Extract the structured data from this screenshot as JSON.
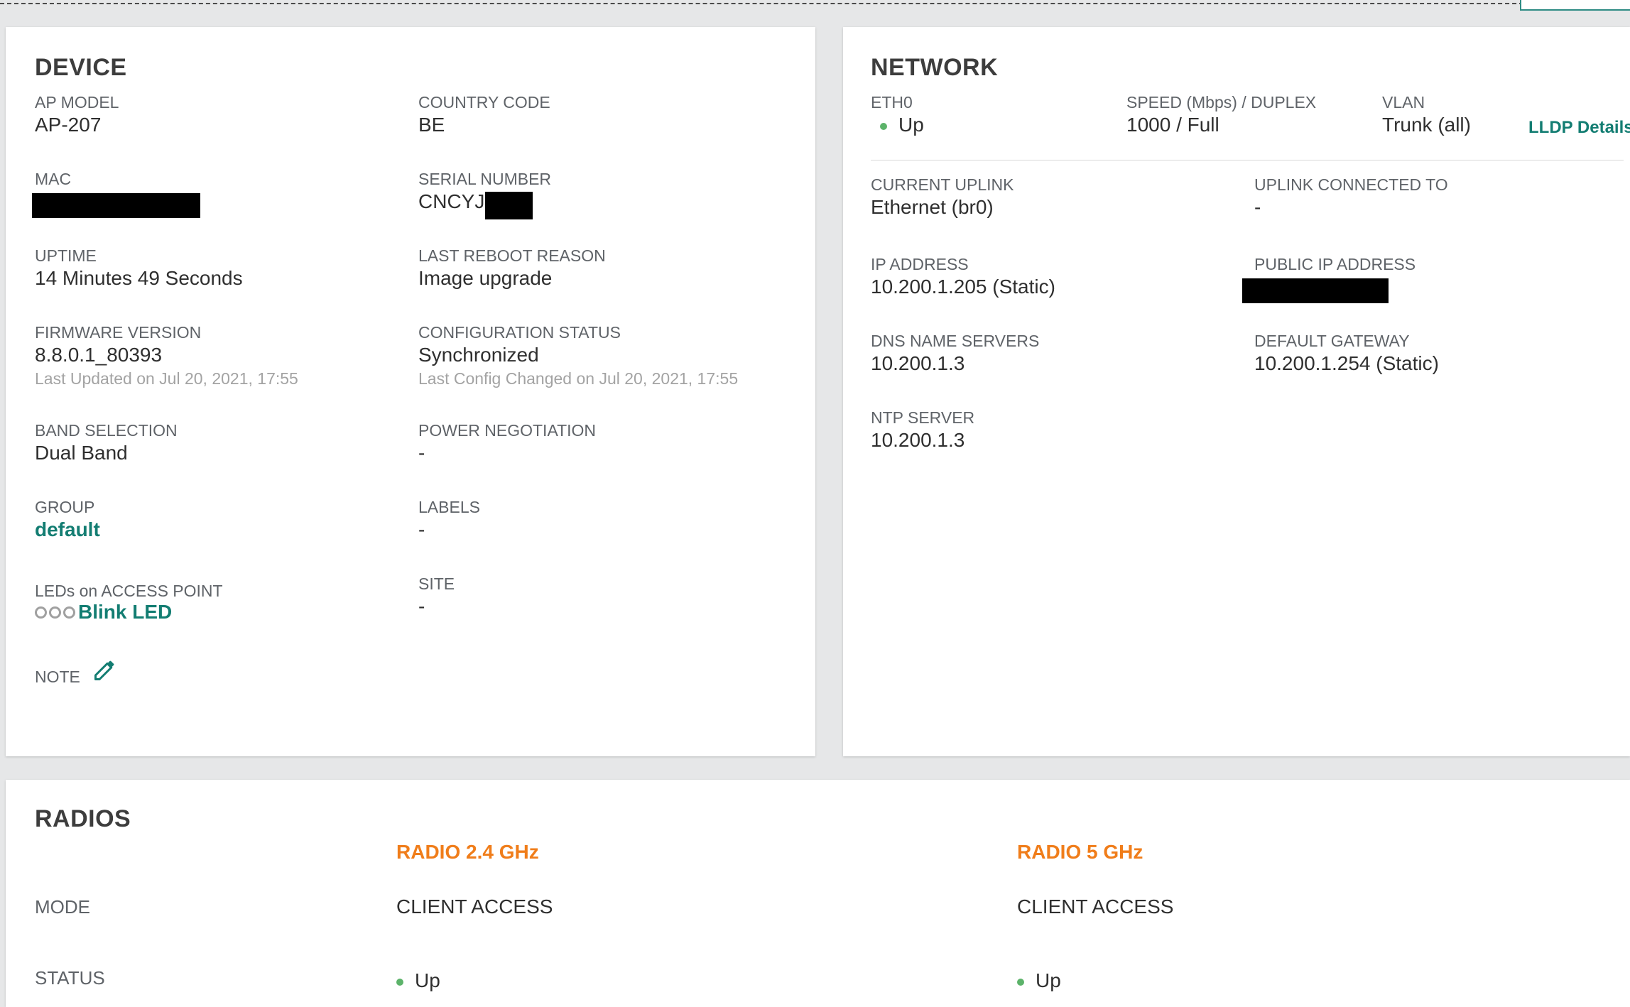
{
  "device": {
    "title": "DEVICE",
    "ap_model_label": "AP MODEL",
    "ap_model": "AP-207",
    "country_code_label": "COUNTRY CODE",
    "country_code": "BE",
    "mac_label": "MAC",
    "serial_label": "SERIAL NUMBER",
    "serial_prefix": "CNCYJS",
    "uptime_label": "UPTIME",
    "uptime": "14 Minutes 49 Seconds",
    "reboot_label": "LAST REBOOT REASON",
    "reboot_reason": "Image upgrade",
    "firmware_label": "FIRMWARE VERSION",
    "firmware": "8.8.0.1_80393",
    "firmware_updated": "Last Updated on Jul 20, 2021, 17:55",
    "config_label": "CONFIGURATION STATUS",
    "config_status": "Synchronized",
    "config_changed": "Last Config Changed on Jul 20, 2021, 17:55",
    "band_label": "BAND SELECTION",
    "band": "Dual Band",
    "power_label": "POWER NEGOTIATION",
    "power": "-",
    "group_label": "GROUP",
    "group": "default",
    "labels_label": "LABELS",
    "labels": "-",
    "leds_label": "LEDs on ACCESS POINT",
    "blink_led": "Blink LED",
    "site_label": "SITE",
    "site": "-",
    "note_label": "NOTE"
  },
  "network": {
    "title": "NETWORK",
    "eth0_label": "ETH0",
    "eth0_status": "Up",
    "speed_label": "SPEED (Mbps) / DUPLEX",
    "speed": "1000 / Full",
    "vlan_label": "VLAN",
    "vlan": "Trunk (all)",
    "lldp_link": "LLDP Details",
    "uplink_label": "CURRENT UPLINK",
    "uplink": "Ethernet (br0)",
    "uplink_connected_label": "UPLINK CONNECTED TO",
    "uplink_connected": "-",
    "ip_label": "IP ADDRESS",
    "ip": "10.200.1.205 (Static)",
    "public_ip_label": "PUBLIC IP ADDRESS",
    "dns_label": "DNS NAME SERVERS",
    "dns": "10.200.1.3",
    "gateway_label": "DEFAULT GATEWAY",
    "gateway": "10.200.1.254 (Static)",
    "ntp_label": "NTP SERVER",
    "ntp": "10.200.1.3"
  },
  "radios": {
    "title": "RADIOS",
    "radio24_title": "RADIO 2.4 GHz",
    "radio5_title": "RADIO 5 GHz",
    "mode_label": "MODE",
    "radio24_mode": "CLIENT ACCESS",
    "radio5_mode": "CLIENT ACCESS",
    "status_label": "STATUS",
    "radio24_status": "Up",
    "radio5_status": "Up"
  },
  "colors": {
    "accent": "#137d72",
    "radio_orange": "#f07d1a",
    "status_green": "#5cb36a"
  }
}
